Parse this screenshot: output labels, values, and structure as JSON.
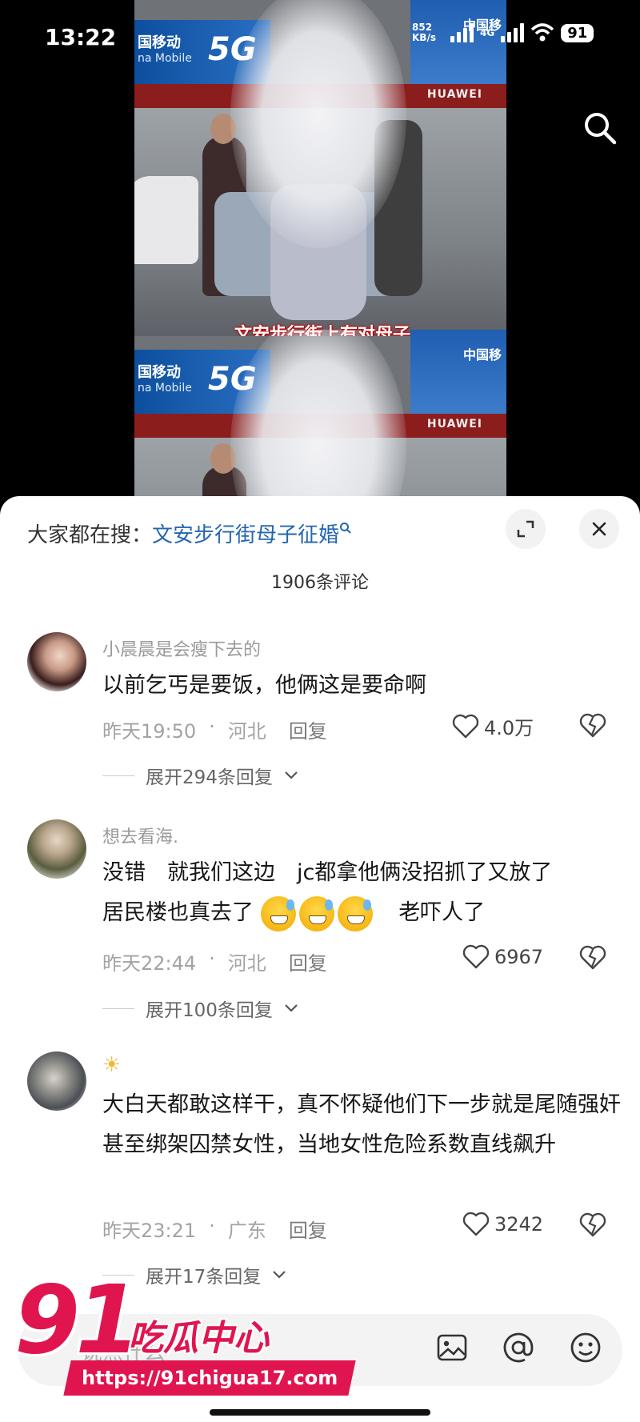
{
  "status_bar": {
    "time": "13:22",
    "net_speed": "852",
    "net_unit": "KB/s",
    "network": "4G",
    "battery": "91"
  },
  "video": {
    "sign_left_cn": "国移动",
    "sign_left_en": "na Mobile",
    "sign_5g": "5G",
    "sign_right": "中国移",
    "store_brand": "HUAWEI",
    "subtitle": "文安步行街上有对母子",
    "search_icon": "search-icon"
  },
  "sheet": {
    "search_prefix": "大家都在搜：",
    "search_query": "文安步行街母子征婚",
    "comment_count": "1906条评论",
    "expand_icon": "expand-icon",
    "close_icon": "close-icon"
  },
  "comments": [
    {
      "username": "小晨晨是会瘦下去的",
      "text": "以前乞丐是要饭，他俩这是要命啊",
      "time": "昨天19:50",
      "location": "河北",
      "reply": "回复",
      "likes": "4.0万",
      "expand": "展开294条回复"
    },
    {
      "username": "想去看海.",
      "text_line1": "没错　就我们这边　jc都拿他俩没招抓了又放了",
      "text_line2a": "居民楼也真去了",
      "text_line2b": "老吓人了",
      "time": "昨天22:44",
      "location": "河北",
      "reply": "回复",
      "likes": "6967",
      "expand": "展开100条回复"
    },
    {
      "username": "☀",
      "text": "大白天都敢这样干，真不怀疑他们下一步就是尾随强奸甚至绑架囚禁女性，当地女性危险系数直线飙升",
      "time": "昨天23:21",
      "location": "广东",
      "reply": "回复",
      "likes": "3242",
      "expand": "展开17条回复"
    }
  ],
  "input_bar": {
    "placeholder": "说点什么",
    "icons": [
      "image-icon",
      "at-icon",
      "emoji-icon"
    ]
  },
  "watermark": {
    "number": "91",
    "name": "吃瓜中心",
    "url": "https://91chigua17.com"
  },
  "colors": {
    "accent_link": "#2466b0",
    "watermark": "#e0154f"
  }
}
